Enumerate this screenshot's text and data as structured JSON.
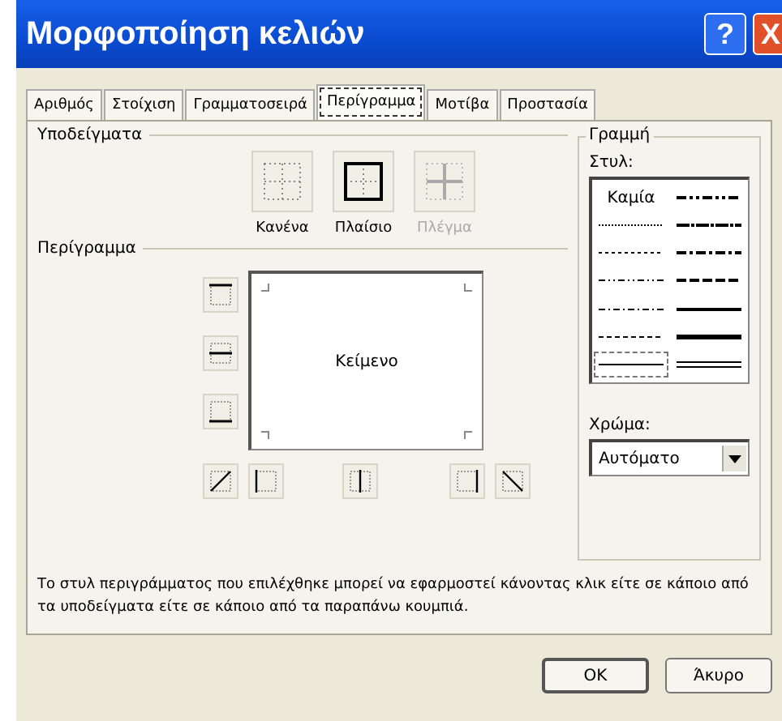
{
  "window": {
    "title": "Μορφοποίηση κελιών",
    "help": "?",
    "close": "X"
  },
  "tabs": [
    {
      "label": "Αριθμός",
      "selected": false
    },
    {
      "label": "Στοίχιση",
      "selected": false
    },
    {
      "label": "Γραμματοσειρά",
      "selected": false
    },
    {
      "label": "Περίγραμμα",
      "selected": true
    },
    {
      "label": "Μοτίβα",
      "selected": false
    },
    {
      "label": "Προστασία",
      "selected": false
    }
  ],
  "presets": {
    "title": "Υποδείγματα",
    "items": [
      {
        "kind": "none",
        "label": "Κανένα",
        "disabled": false
      },
      {
        "kind": "outline",
        "label": "Πλαίσιο",
        "disabled": false
      },
      {
        "kind": "inside",
        "label": "Πλέγμα",
        "disabled": true
      }
    ]
  },
  "border": {
    "title": "Περίγραμμα",
    "preview_text": "Κείμενο",
    "side_buttons": [
      {
        "kind": "top"
      },
      {
        "kind": "middle"
      },
      {
        "kind": "bottom"
      }
    ],
    "bottom_buttons": [
      {
        "kind": "diag-up"
      },
      {
        "kind": "left"
      },
      {
        "kind": "center"
      },
      {
        "kind": "right"
      },
      {
        "kind": "diag-down"
      }
    ]
  },
  "line": {
    "title": "Γραμμή",
    "style_label": "Στυλ:",
    "color_label": "Χρώμα:",
    "color_value": "Αυτόματο",
    "styles": [
      {
        "kind": "none",
        "label": "Καμία",
        "selected": false
      },
      {
        "kind": "hair",
        "selected": false
      },
      {
        "kind": "dotted",
        "selected": false
      },
      {
        "kind": "dash-dot-dot",
        "selected": false
      },
      {
        "kind": "dash-dot",
        "selected": false
      },
      {
        "kind": "dashed",
        "selected": false
      },
      {
        "kind": "thin",
        "selected": true
      },
      {
        "kind": "medium-dash-dot-dot",
        "selected": false
      },
      {
        "kind": "slant-dash-dot",
        "selected": false
      },
      {
        "kind": "medium-dash-dot",
        "selected": false
      },
      {
        "kind": "medium-dashed",
        "selected": false
      },
      {
        "kind": "medium",
        "selected": false
      },
      {
        "kind": "thick",
        "selected": false
      },
      {
        "kind": "double",
        "selected": false
      }
    ]
  },
  "note": "Το στυλ περιγράμματος που επιλέχθηκε μπορεί να εφαρμοστεί κάνοντας κλικ είτε σε κάποιο από τα υποδείγματα είτε σε κάποιο από τα παραπάνω κουμπιά.",
  "buttons": [
    "OK",
    "Άκυρο"
  ]
}
